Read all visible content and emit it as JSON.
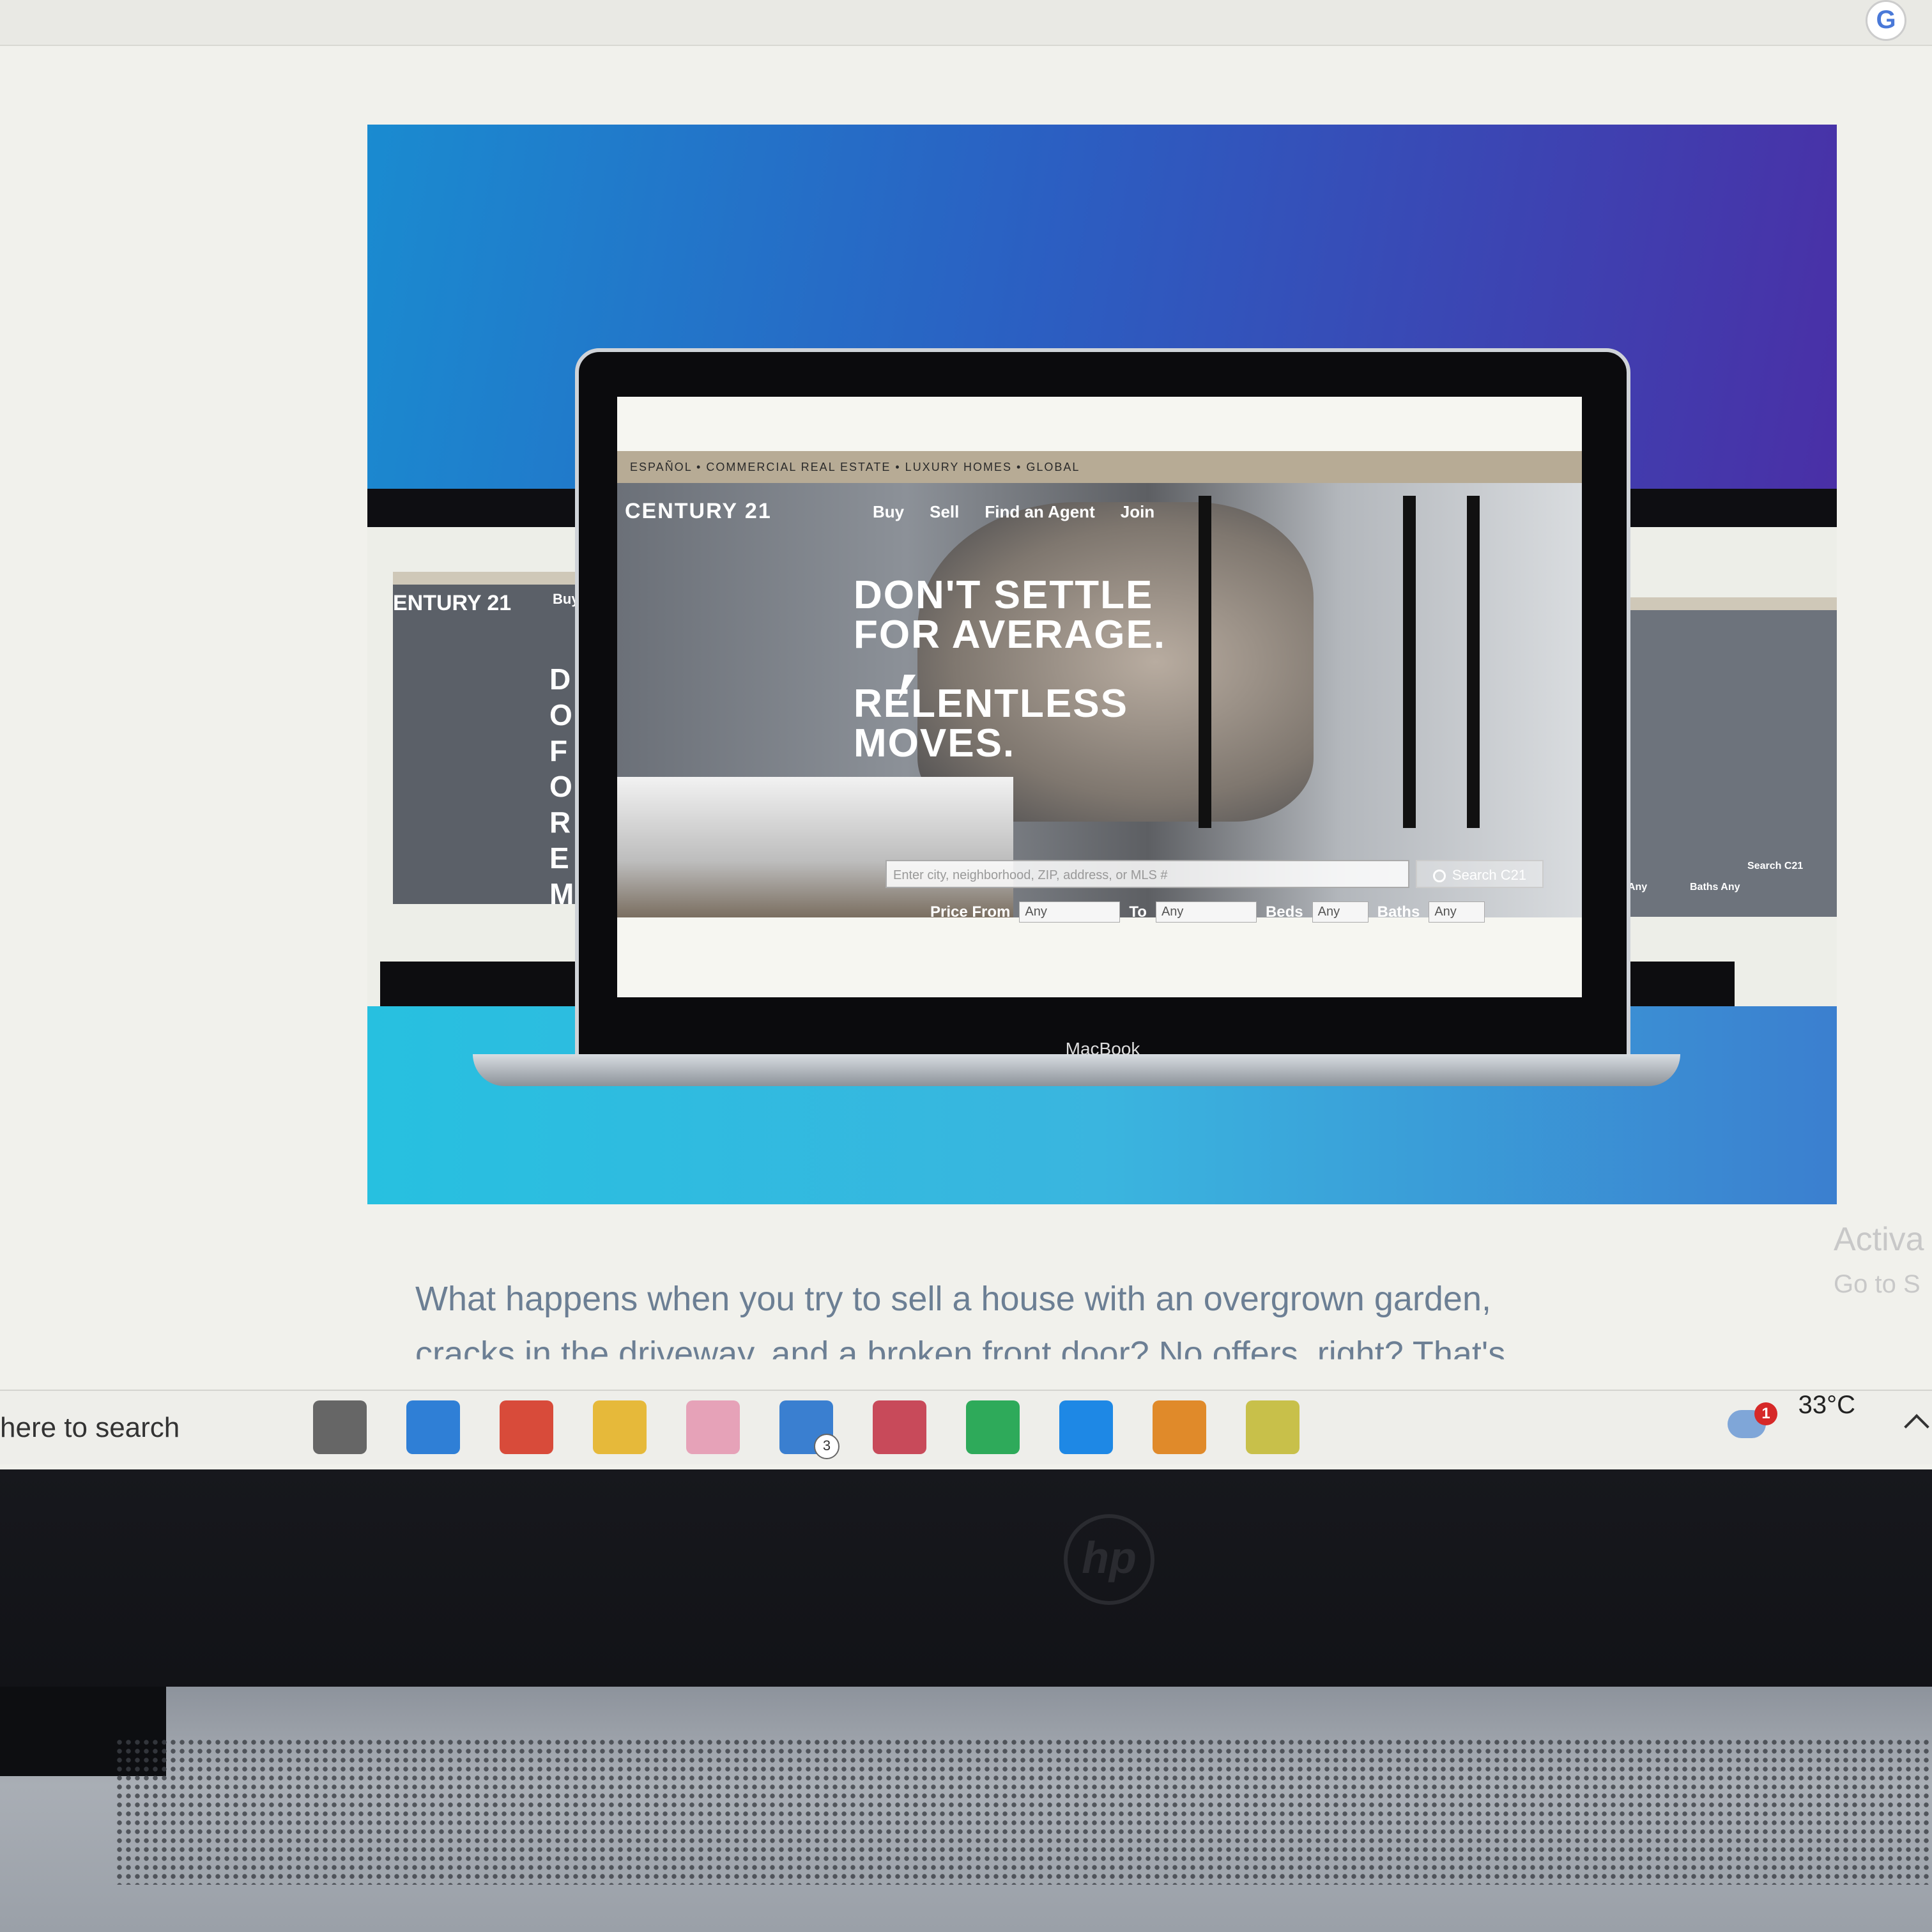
{
  "browser": {
    "profile_badge": "G"
  },
  "hero": {
    "device_label": "MacBook",
    "site": {
      "utility_nav": "ESPAÑOL • COMMERCIAL REAL ESTATE • LUXURY HOMES • GLOBAL",
      "logo": "CENTURY 21",
      "nav": [
        "Buy",
        "Sell",
        "Find an Agent",
        "Join"
      ],
      "headline_line1": "DON'T SETTLE",
      "headline_line2": "FOR AVERAGE.",
      "headline_line3": "RELENTLESS",
      "headline_line4": "MOVES.",
      "search_placeholder": "Enter city, neighborhood, ZIP, address, or MLS #",
      "search_button": "Search C21",
      "filters": {
        "price_from_label": "Price From",
        "price_from_value": "Any",
        "to_label": "To",
        "to_value": "Any",
        "beds_label": "Beds",
        "beds_value": "Any",
        "baths_label": "Baths",
        "baths_value": "Any"
      }
    },
    "left_reflection": {
      "logo": "ENTURY 21",
      "nav": "Buy",
      "headline": "DO FO RE MO"
    },
    "right_reflection": {
      "beds": "Beds Any",
      "baths": "Baths Any",
      "search": "Search C21"
    }
  },
  "article": {
    "line1": "What happens when you try to sell a house with an overgrown garden,",
    "line2": "cracks in the driveway, and a broken front door? No offers, right? That's"
  },
  "watermark": {
    "line1": "Activa",
    "line2": "Go to S"
  },
  "taskbar": {
    "search_text": "here to search",
    "icons": [
      {
        "name": "task-view-icon",
        "color": "#666666"
      },
      {
        "name": "store-icon",
        "color": "#2f7fd6"
      },
      {
        "name": "chrome-icon",
        "color": "#d84b3a"
      },
      {
        "name": "file-explorer-icon",
        "color": "#e6b93a"
      },
      {
        "name": "music-icon",
        "color": "#e6a2b8"
      },
      {
        "name": "mail-icon",
        "color": "#3a7fd0",
        "badge": "3"
      },
      {
        "name": "office-icon",
        "color": "#c84a5a"
      },
      {
        "name": "pycharm-icon",
        "color": "#2eaa5a"
      },
      {
        "name": "vscode-icon",
        "color": "#1e88e5"
      },
      {
        "name": "fl-studio-icon",
        "color": "#e08a2a"
      },
      {
        "name": "sticky-notes-icon",
        "color": "#c8c04a"
      }
    ],
    "weather_alert": "1",
    "temperature": "33°C"
  },
  "laptop": {
    "brand": "hp"
  }
}
